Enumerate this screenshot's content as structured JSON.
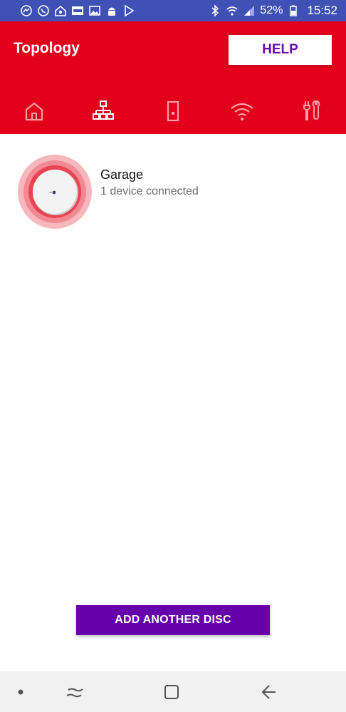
{
  "status_bar": {
    "battery_percent": "52%",
    "time": "15:52",
    "left_icons": [
      "messenger-icon",
      "whatsapp-icon",
      "home-app-icon",
      "ebay-icon",
      "gallery-icon",
      "android-icon",
      "play-store-icon"
    ],
    "right_icons": [
      "bluetooth-icon",
      "wifi-icon",
      "signal-icon",
      "battery-icon"
    ]
  },
  "header": {
    "title": "Topology",
    "help_label": "HELP",
    "background_color": "#e3001b"
  },
  "tabs": [
    {
      "icon": "home-icon",
      "active": false
    },
    {
      "icon": "topology-icon",
      "active": true
    },
    {
      "icon": "device-icon",
      "active": false
    },
    {
      "icon": "wifi-icon",
      "active": false
    },
    {
      "icon": "tools-icon",
      "active": false
    }
  ],
  "discs": [
    {
      "name": "Garage",
      "status": "1 device connected"
    }
  ],
  "footer": {
    "add_disc_label": "ADD ANOTHER DISC",
    "button_color": "#6600aa"
  },
  "nav": {
    "icons": [
      "dot-icon",
      "recent-apps-icon",
      "home-square-icon",
      "back-icon"
    ]
  }
}
